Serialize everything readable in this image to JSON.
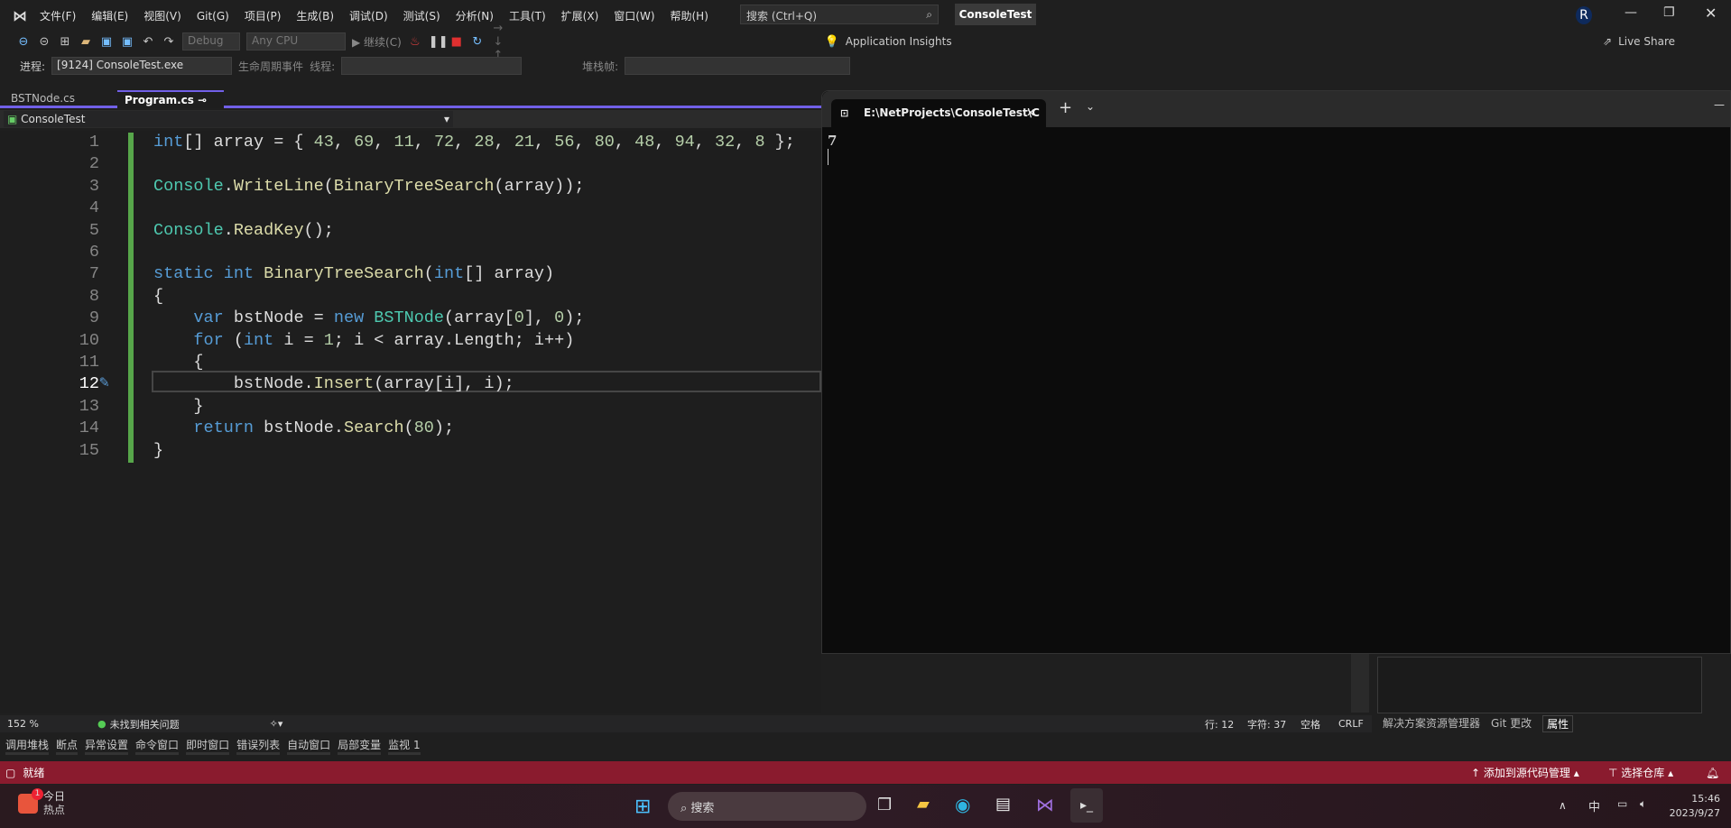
{
  "titlebar": {
    "menu": [
      "文件(F)",
      "编辑(E)",
      "视图(V)",
      "Git(G)",
      "项目(P)",
      "生成(B)",
      "调试(D)",
      "测试(S)",
      "分析(N)",
      "工具(T)",
      "扩展(X)",
      "窗口(W)",
      "帮助(H)"
    ],
    "search_placeholder": "搜索 (Ctrl+Q)",
    "project": "ConsoleTest",
    "avatar": "R"
  },
  "toolbar": {
    "config": "Debug",
    "platform": "Any CPU",
    "continue": "继续(C)",
    "app_insights": "Application Insights",
    "live_share": "Live Share"
  },
  "debugbar": {
    "process_label": "进程:",
    "process": "[9124] ConsoleTest.exe",
    "lifecycle": "生命周期事件",
    "thread_label": "线程:",
    "stack_label": "堆栈帧:"
  },
  "tabs": [
    {
      "label": "BSTNode.cs"
    },
    {
      "label": "Program.cs",
      "active": true
    }
  ],
  "navbar": {
    "scope": "ConsoleTest"
  },
  "code": {
    "lines": [
      "int[] array = { 43, 69, 11, 72, 28, 21, 56, 80, 48, 94, 32, 8 };",
      "",
      "Console.WriteLine(BinaryTreeSearch(array));",
      "",
      "Console.ReadKey();",
      "",
      "static int BinaryTreeSearch(int[] array)",
      "{",
      "    var bstNode = new BSTNode(array[0], 0);",
      "    for (int i = 1; i < array.Length; i++)",
      "    {",
      "        bstNode.Insert(array[i], i);",
      "    }",
      "    return bstNode.Search(80);",
      "}"
    ],
    "current_line": 12
  },
  "terminal": {
    "tab_title": "E:\\NetProjects\\ConsoleTest\\C",
    "output": "7"
  },
  "editor_status": {
    "zoom": "152 %",
    "issues": "未找到相关问题",
    "line": "行: 12",
    "char": "字符: 37",
    "spaces": "空格",
    "eol": "CRLF"
  },
  "right_tabs": [
    "解决方案资源管理器",
    "Git 更改",
    "属性"
  ],
  "bottom_tabs": [
    "调用堆栈",
    "断点",
    "异常设置",
    "命令窗口",
    "即时窗口",
    "错误列表",
    "自动窗口",
    "局部变量",
    "监视 1"
  ],
  "status": {
    "ready": "就绪",
    "add_source": "添加到源代码管理",
    "select_repo": "选择仓库",
    "color": "#8a1b2e"
  },
  "taskbar": {
    "news_title": "今日",
    "news_sub": "热点",
    "news_badge": "1",
    "search": "搜索",
    "ime": "中",
    "time": "15:46",
    "date": "2023/9/27"
  }
}
